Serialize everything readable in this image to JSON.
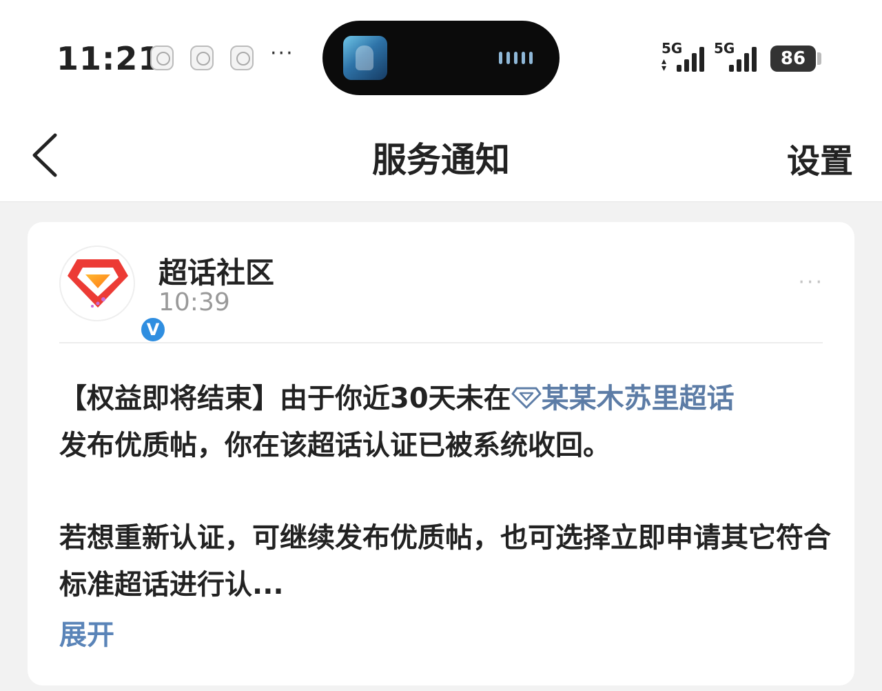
{
  "status_bar": {
    "time": "11:21",
    "overflow_dots": "···",
    "network_1": "5G",
    "network_2": "5G",
    "battery_level": "86",
    "notification_icons": [
      "weibo-app-icon",
      "weibo-app-icon",
      "hotspot-app-icon"
    ]
  },
  "nav": {
    "title": "服务通知",
    "settings_label": "设置"
  },
  "notification": {
    "sender": "超话社区",
    "time": "10:39",
    "more_label": "···",
    "message_prefix": "【权益即将结束】由于你近30天未在",
    "topic_name": "某某木苏里超话",
    "message_suffix": "发布优质帖，你在该超话认证已被系统收回。",
    "message_second": "若想重新认证，可继续发布优质帖，也可选择立即申请其它符合标准超话进行认...",
    "expand_label": "展开",
    "verified_badge": "V"
  },
  "colors": {
    "link": "#5c7ca6",
    "expand": "#5a84b8",
    "badge": "#2f8ee0",
    "background": "#f2f2f2"
  }
}
